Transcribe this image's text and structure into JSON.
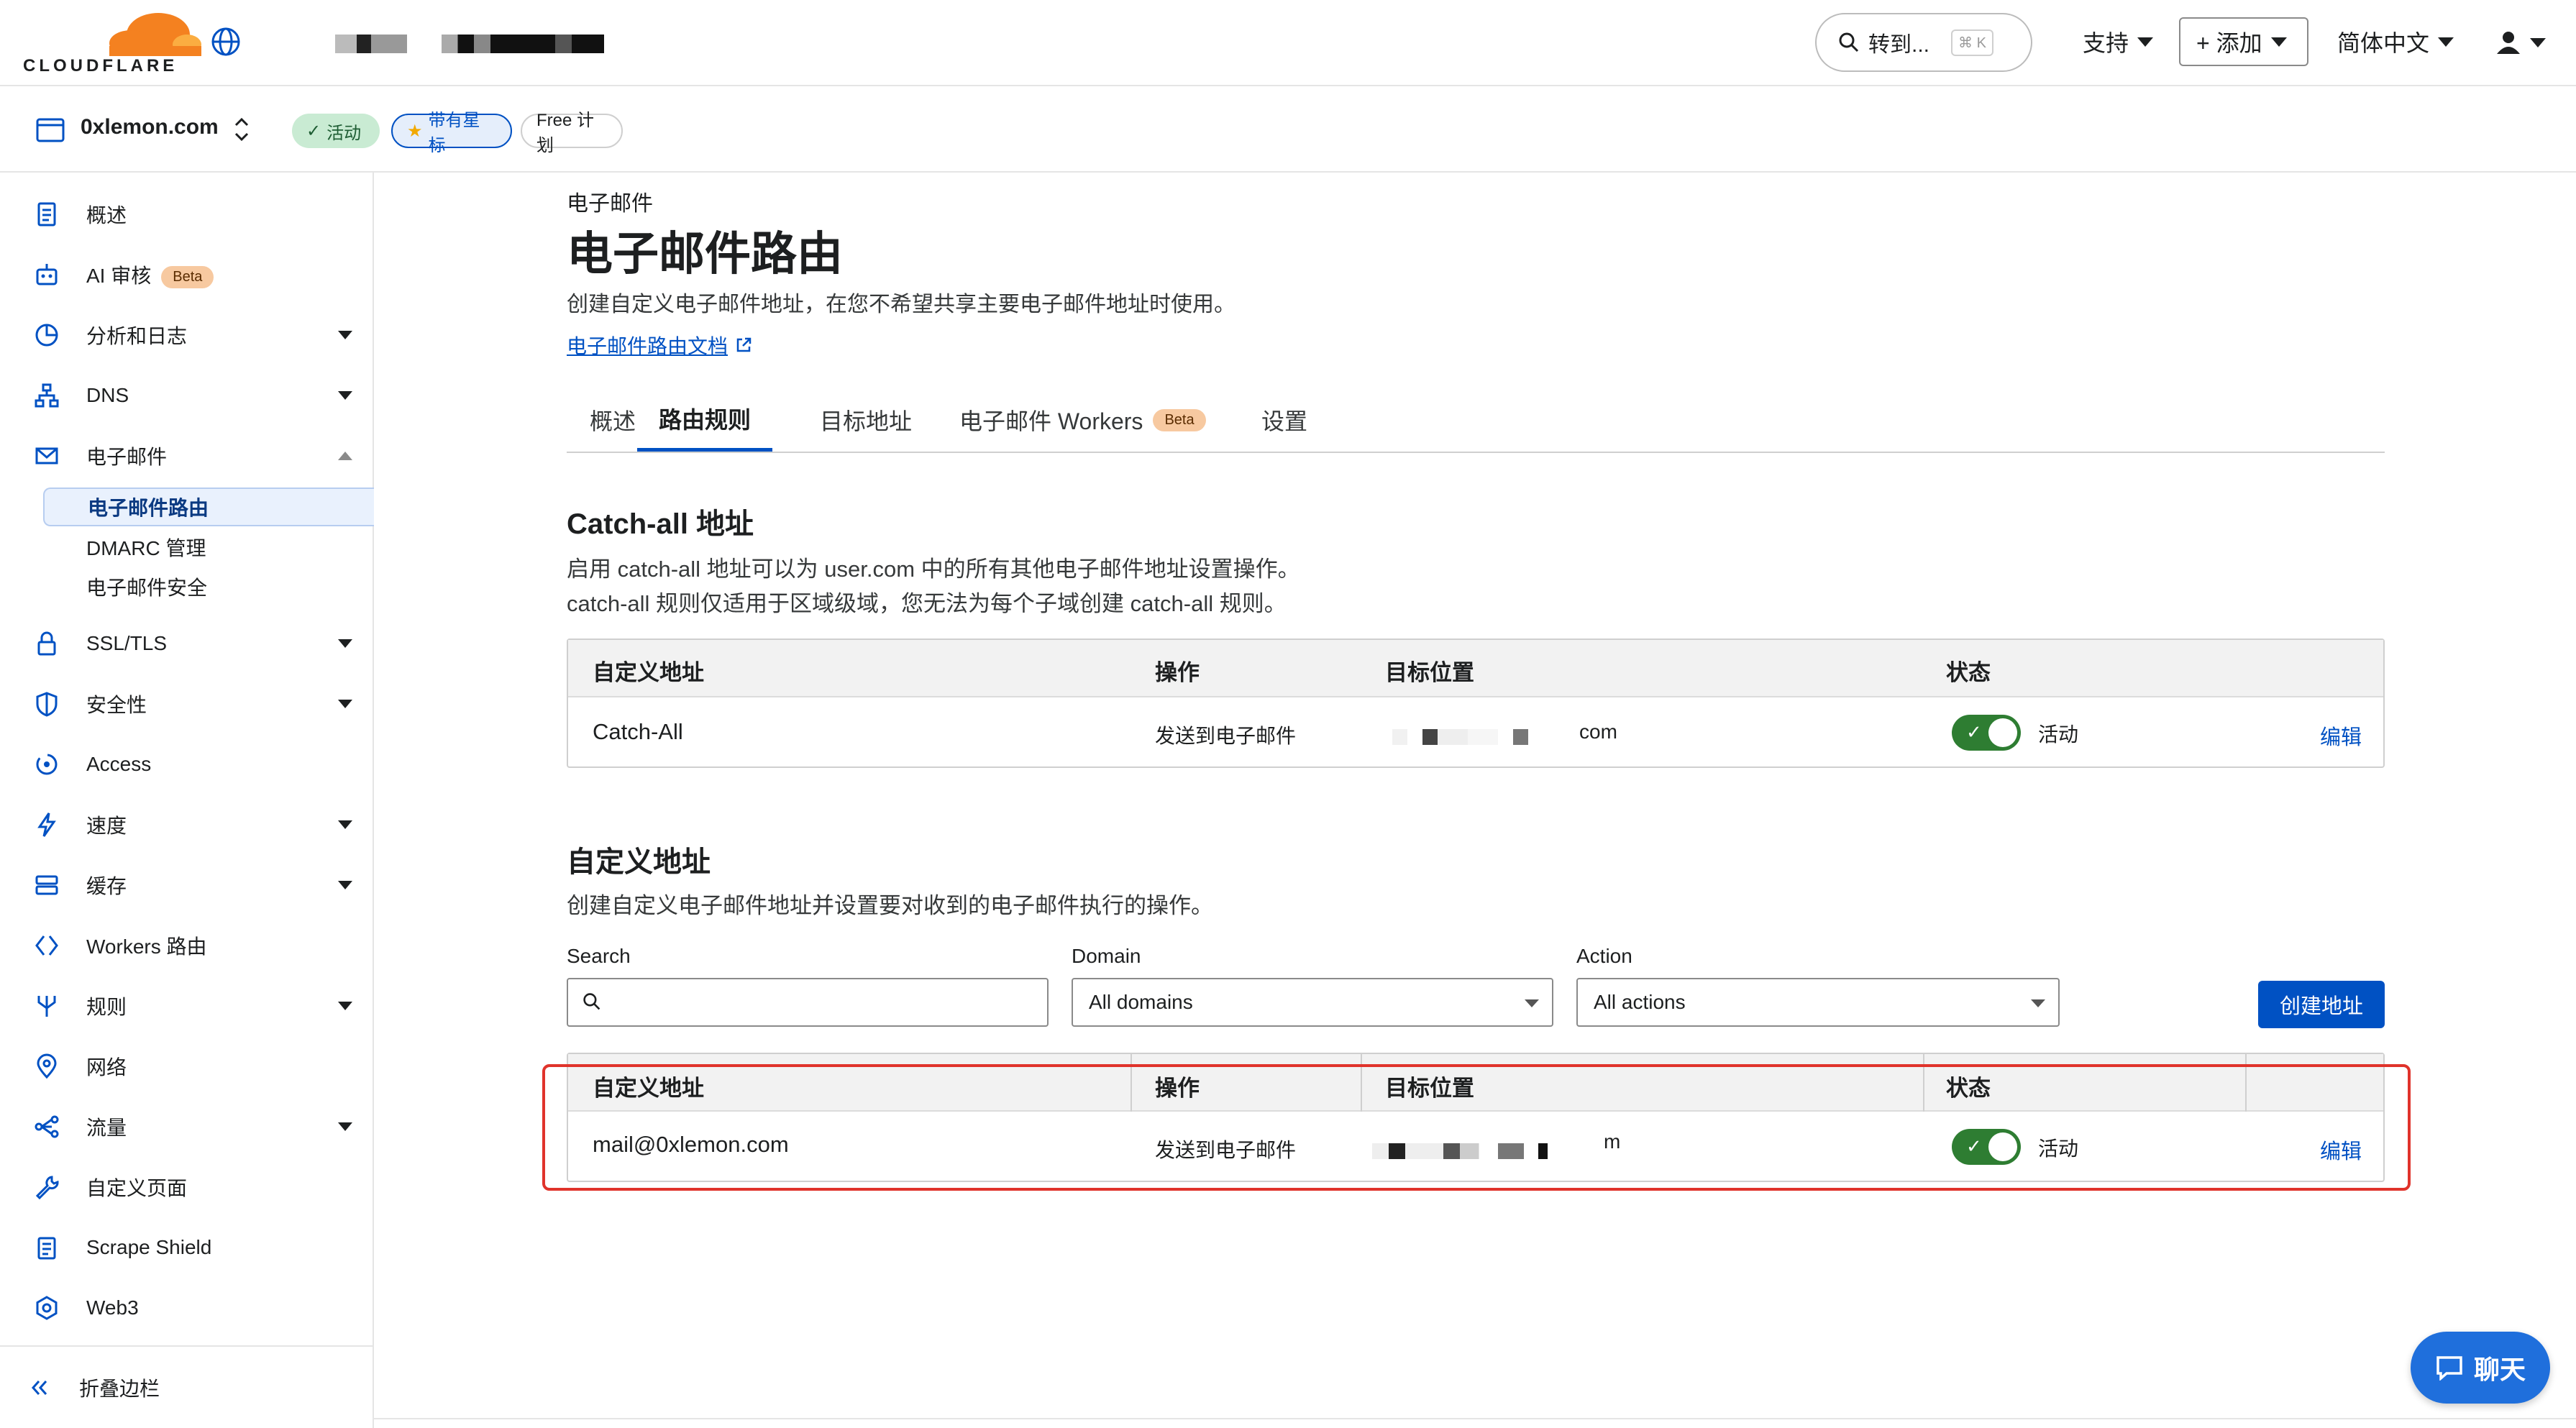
{
  "brand": {
    "logo_text": "CLOUDFLARE",
    "accent": "#f48120",
    "link_color": "#0051c3"
  },
  "topbar": {
    "search_label": "转到...",
    "search_shortcut": "⌘ K",
    "support_label": "支持",
    "add_label": "+ 添加",
    "language_label": "简体中文"
  },
  "zone": {
    "site": "0xlemon.com",
    "status_badge": "活动",
    "star_badge": "带有星标",
    "plan_badge": "Free 计划"
  },
  "sidebar": {
    "items": [
      {
        "label": "概述",
        "icon": "document-icon"
      },
      {
        "label": "AI 审核",
        "icon": "robot-icon",
        "beta": "Beta"
      },
      {
        "label": "分析和日志",
        "icon": "chart-pie-icon"
      },
      {
        "label": "DNS",
        "icon": "network-icon"
      },
      {
        "label": "电子邮件",
        "icon": "mail-icon"
      },
      {
        "label": "SSL/TLS",
        "icon": "lock-icon"
      },
      {
        "label": "安全性",
        "icon": "shield-icon"
      },
      {
        "label": "Access",
        "icon": "access-icon"
      },
      {
        "label": "速度",
        "icon": "bolt-icon"
      },
      {
        "label": "缓存",
        "icon": "server-icon"
      },
      {
        "label": "Workers 路由",
        "icon": "workers-icon"
      },
      {
        "label": "规则",
        "icon": "rules-icon"
      },
      {
        "label": "网络",
        "icon": "location-pin-icon"
      },
      {
        "label": "流量",
        "icon": "traffic-icon"
      },
      {
        "label": "自定义页面",
        "icon": "wrench-icon"
      },
      {
        "label": "Scrape Shield",
        "icon": "clipboard-icon"
      },
      {
        "label": "Web3",
        "icon": "web3-icon"
      }
    ],
    "email_sub": [
      "电子邮件路由",
      "DMARC 管理",
      "电子邮件安全"
    ],
    "collapse_label": "折叠边栏"
  },
  "page": {
    "crumb": "电子邮件",
    "title": "电子邮件路由",
    "desc": "创建自定义电子邮件地址，在您不希望共享主要电子邮件地址时使用。",
    "doc_link": "电子邮件路由文档"
  },
  "tabs": [
    {
      "label": "概述"
    },
    {
      "label": "路由规则"
    },
    {
      "label": "目标地址"
    },
    {
      "label": "电子邮件 Workers",
      "beta": "Beta"
    },
    {
      "label": "设置"
    }
  ],
  "catchall": {
    "title": "Catch-all 地址",
    "desc1": "启用 catch-all 地址可以为 user.com 中的所有其他电子邮件地址设置操作。",
    "desc2": "catch-all 规则仅适用于区域级域，您无法为每个子域创建 catch-all 规则。",
    "headers": [
      "自定义地址",
      "操作",
      "目标位置",
      "状态"
    ],
    "row": {
      "address": "Catch-All",
      "action": "发送到电子邮件",
      "dest_suffix": "com",
      "status": "活动",
      "edit": "编辑"
    }
  },
  "custom": {
    "title": "自定义地址",
    "desc": "创建自定义电子邮件地址并设置要对收到的电子邮件执行的操作。",
    "search_label": "Search",
    "domain_label": "Domain",
    "domain_value": "All domains",
    "action_label": "Action",
    "action_value": "All actions",
    "create_button": "创建地址",
    "headers": [
      "自定义地址",
      "操作",
      "目标位置",
      "状态"
    ],
    "row": {
      "address": "mail@0xlemon.com",
      "action": "发送到电子邮件",
      "dest_suffix": "m",
      "status": "活动",
      "edit": "编辑"
    }
  },
  "chat_label": "聊天"
}
